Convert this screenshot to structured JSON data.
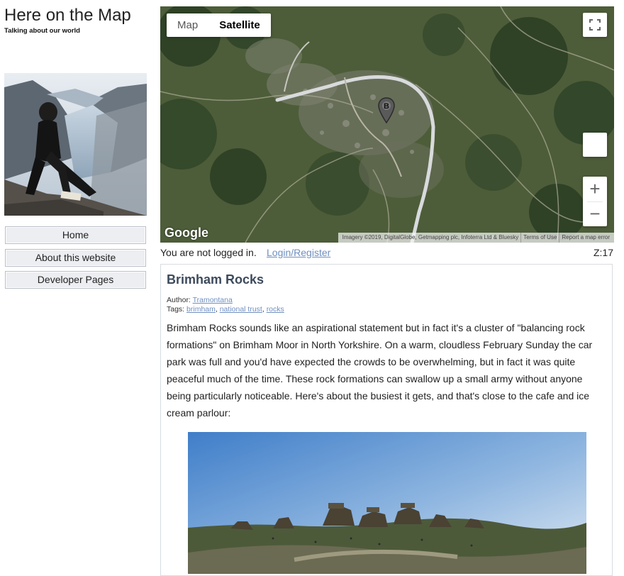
{
  "site": {
    "title": "Here on the Map",
    "tagline": "Talking about our world"
  },
  "nav": {
    "items": [
      {
        "label": "Home"
      },
      {
        "label": "About this website"
      },
      {
        "label": "Developer Pages"
      }
    ]
  },
  "map": {
    "type_controls": {
      "map_label": "Map",
      "satellite_label": "Satellite",
      "selected": "Satellite"
    },
    "marker_label": "B",
    "logo": "Google",
    "attribution": {
      "imagery": "Imagery ©2019, DigitalGlobe, Getmapping plc, Infoterra Ltd & Bluesky",
      "terms": "Terms of Use",
      "report": "Report a map error"
    },
    "zoom_in": "+",
    "zoom_out": "−",
    "icons": {
      "fullscreen": "fullscreen-icon",
      "pegman": "pegman-icon",
      "marker": "map-marker-icon"
    }
  },
  "status": {
    "login_text": "You are not logged in.",
    "login_link": "Login/Register",
    "zoom_level": "Z:17"
  },
  "article": {
    "title": "Brimham Rocks",
    "author_label": "Author:",
    "author": "Tramontana",
    "tags_label": "Tags:",
    "tags": [
      "brimham",
      "national trust",
      "rocks"
    ],
    "body": "Brimham Rocks sounds like an aspirational statement but in fact it's a cluster of \"balancing rock formations\" on Brimham Moor in North Yorkshire. On a warm, cloudless February Sunday the car park was full and you'd have expected the crowds to be overwhelming, but in fact it was quite peaceful much of the time. These rock formations can swallow up a small army without anyone being particularly noticeable. Here's about the busiest it gets, and that's close to the cafe and ice cream parlour:"
  },
  "colors": {
    "link": "#6f8fc0",
    "article_title": "#3c4a5c",
    "nav_button_bg": "#eceef1"
  }
}
